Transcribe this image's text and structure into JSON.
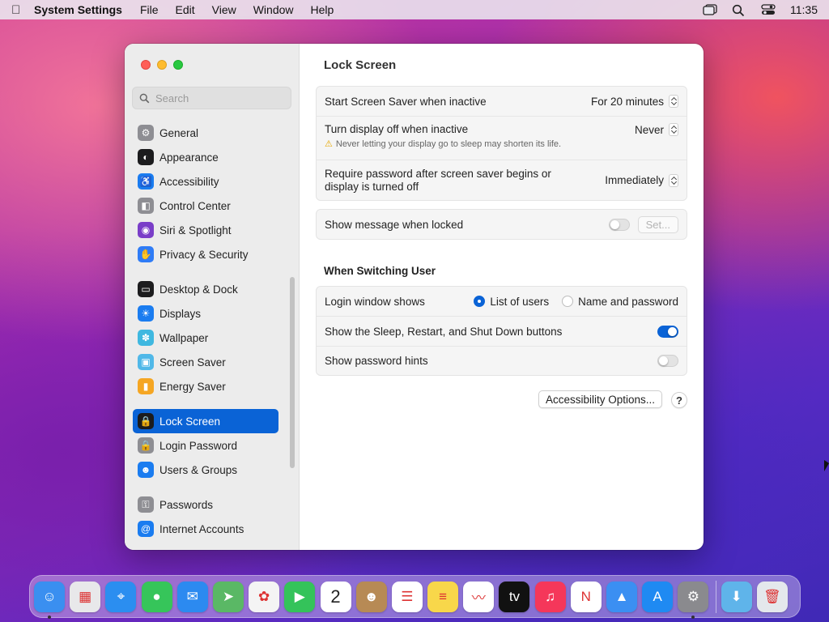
{
  "menubar": {
    "app_name": "System Settings",
    "menus": [
      "File",
      "Edit",
      "View",
      "Window",
      "Help"
    ],
    "clock": "11:35"
  },
  "sidebar": {
    "search_placeholder": "Search",
    "groups": [
      [
        {
          "label": "General",
          "icon": "gear-icon",
          "color": "#8e8e93"
        },
        {
          "label": "Appearance",
          "icon": "appearance-icon",
          "color": "#1c1c1e"
        },
        {
          "label": "Accessibility",
          "icon": "accessibility-icon",
          "color": "#1a7cf0"
        },
        {
          "label": "Control Center",
          "icon": "control-center-icon",
          "color": "#8e8e93"
        },
        {
          "label": "Siri & Spotlight",
          "icon": "siri-icon",
          "color": "#7a3ec8"
        },
        {
          "label": "Privacy & Security",
          "icon": "hand-icon",
          "color": "#2f7cf6"
        }
      ],
      [
        {
          "label": "Desktop & Dock",
          "icon": "dock-icon",
          "color": "#1c1c1e"
        },
        {
          "label": "Displays",
          "icon": "sun-icon",
          "color": "#1a7cf0"
        },
        {
          "label": "Wallpaper",
          "icon": "flower-icon",
          "color": "#3fb8e0"
        },
        {
          "label": "Screen Saver",
          "icon": "screen-saver-icon",
          "color": "#50b8e8"
        },
        {
          "label": "Energy Saver",
          "icon": "battery-icon",
          "color": "#f5a623"
        }
      ],
      [
        {
          "label": "Lock Screen",
          "icon": "lock-icon",
          "color": "#1c1c1e",
          "active": true
        },
        {
          "label": "Login Password",
          "icon": "lock-icon",
          "color": "#8e8e93"
        },
        {
          "label": "Users & Groups",
          "icon": "users-icon",
          "color": "#1a7cf0"
        }
      ],
      [
        {
          "label": "Passwords",
          "icon": "key-icon",
          "color": "#8e8e93"
        },
        {
          "label": "Internet Accounts",
          "icon": "at-icon",
          "color": "#1a7cf0"
        }
      ]
    ]
  },
  "main": {
    "title": "Lock Screen",
    "screen_saver": {
      "label": "Start Screen Saver when inactive",
      "value": "For 20 minutes"
    },
    "display_off": {
      "label": "Turn display off when inactive",
      "value": "Never",
      "warning": "Never letting your display go to sleep may shorten its life."
    },
    "require_password": {
      "label_line1": "Require password after screen saver begins or",
      "label_line2": "display is turned off",
      "value": "Immediately"
    },
    "show_message": {
      "label": "Show message when locked",
      "enabled": false,
      "button": "Set..."
    },
    "switching_title": "When Switching User",
    "login_window": {
      "label": "Login window shows",
      "options": [
        "List of users",
        "Name and password"
      ],
      "selected": "List of users"
    },
    "sleep_buttons": {
      "label": "Show the Sleep, Restart, and Shut Down buttons",
      "enabled": true
    },
    "password_hints": {
      "label": "Show password hints",
      "enabled": false
    },
    "accessibility_button": "Accessibility Options...",
    "help_button": "?"
  },
  "dock": {
    "apps": [
      {
        "name": "finder-icon",
        "color": "#3a8ff0",
        "glyph": "☺",
        "running": true
      },
      {
        "name": "launchpad-icon",
        "color": "#e8e8ea",
        "glyph": "▦"
      },
      {
        "name": "safari-icon",
        "color": "#2b8ef0",
        "glyph": "⌖"
      },
      {
        "name": "messages-icon",
        "color": "#36c55a",
        "glyph": "●"
      },
      {
        "name": "mail-icon",
        "color": "#2c8af0",
        "glyph": "✉"
      },
      {
        "name": "maps-icon",
        "color": "#5ab865",
        "glyph": "➤"
      },
      {
        "name": "photos-icon",
        "color": "#f4f4f4",
        "glyph": "✿"
      },
      {
        "name": "facetime-icon",
        "color": "#34c35a",
        "glyph": "▶"
      },
      {
        "name": "calendar-icon",
        "color": "#ffffff",
        "glyph": "2"
      },
      {
        "name": "contacts-icon",
        "color": "#b78a55",
        "glyph": "☻"
      },
      {
        "name": "reminders-icon",
        "color": "#ffffff",
        "glyph": "☰"
      },
      {
        "name": "notes-icon",
        "color": "#f8d74a",
        "glyph": "≡"
      },
      {
        "name": "freeform-icon",
        "color": "#ffffff",
        "glyph": "〰"
      },
      {
        "name": "tv-icon",
        "color": "#111111",
        "glyph": "tv"
      },
      {
        "name": "music-icon",
        "color": "#f5375a",
        "glyph": "♫"
      },
      {
        "name": "news-icon",
        "color": "#ffffff",
        "glyph": "N"
      },
      {
        "name": "keynote-icon",
        "color": "#3b8ff2",
        "glyph": "▲"
      },
      {
        "name": "app-store-icon",
        "color": "#1f8af2",
        "glyph": "A"
      },
      {
        "name": "system-settings-icon",
        "color": "#8a8a8e",
        "glyph": "⚙",
        "running": true
      }
    ],
    "extras": [
      {
        "name": "downloads-folder-icon",
        "color": "#5fb4ea",
        "glyph": "⬇"
      },
      {
        "name": "trash-icon",
        "color": "#e4e8ec",
        "glyph": "🗑"
      }
    ]
  }
}
